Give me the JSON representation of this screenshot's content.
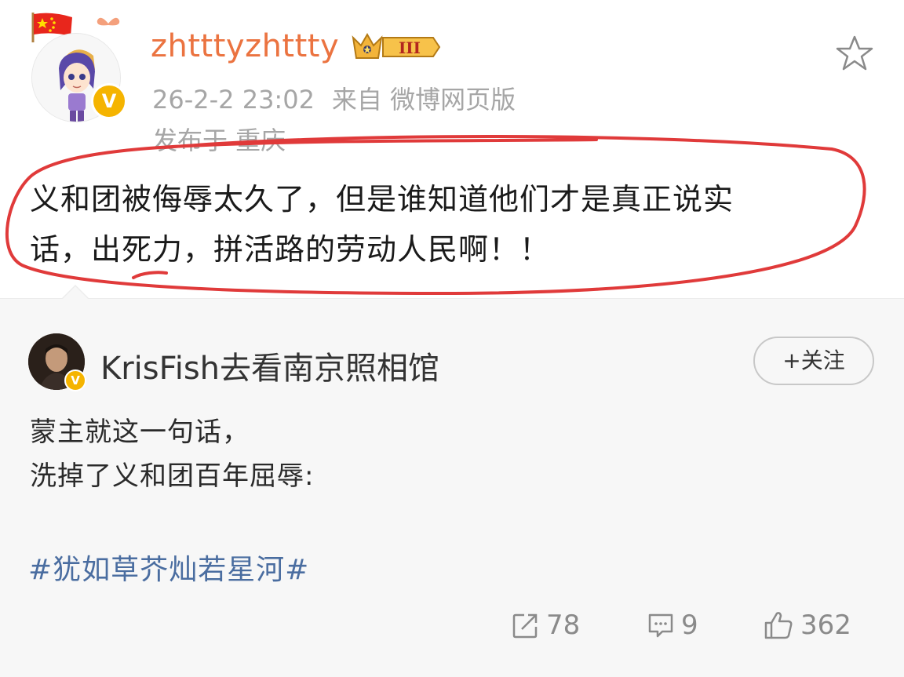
{
  "post": {
    "username": "zhtttyzhttty",
    "level_badge": "III",
    "timestamp": "26-2-2 23:02",
    "source": "来自 微博网页版",
    "location": "发布于 重庆",
    "content_line1": "义和团被侮辱太久了，但是谁知道他们才是真正说实",
    "content_line2": "话，出死力，拼活路的劳动人民啊！！",
    "verified_mark": "V"
  },
  "repost": {
    "author": "KrisFish去看南京照相馆",
    "follow_label": "+关注",
    "verified_mark": "V",
    "text_line1": "蒙主就这一句话，",
    "text_line2": "洗掉了义和团百年屈辱:",
    "hashtag": "#犹如草芥灿若星河#"
  },
  "actions": {
    "repost_count": "78",
    "comment_count": "9",
    "like_count": "362"
  },
  "colors": {
    "username": "#eb7340",
    "meta": "#a6a6a6",
    "hashtag": "#4a6da0",
    "annotation_red": "#e03a3a",
    "repost_bg": "#f7f7f7",
    "verified": "#f5b400"
  },
  "icons": {
    "flag": "china-flag-icon",
    "crown": "crown-level-icon",
    "favorite": "star-icon",
    "repost": "repost-icon",
    "comment": "comment-icon",
    "like": "thumbs-up-icon"
  }
}
